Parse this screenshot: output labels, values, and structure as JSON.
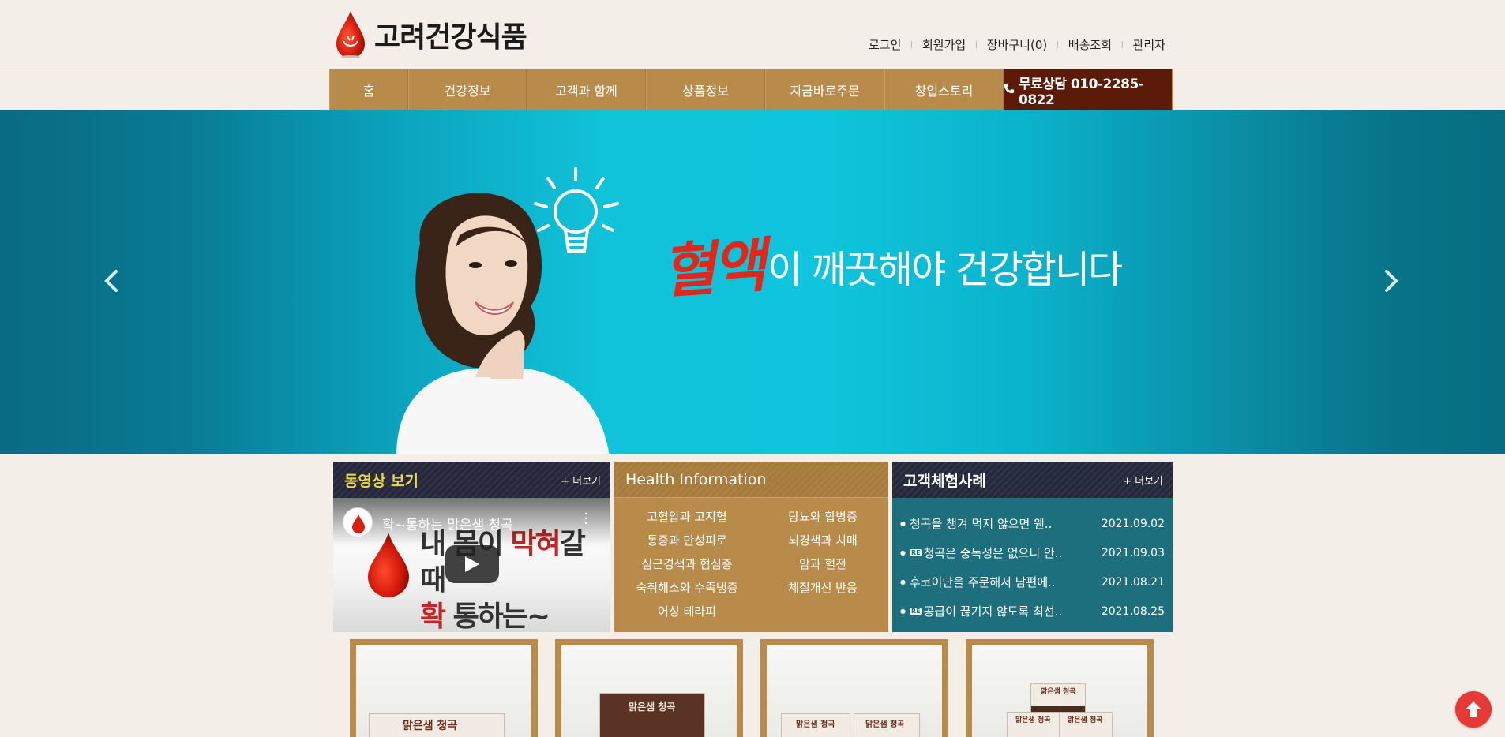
{
  "site": {
    "title": "고려건강식품"
  },
  "util_links": [
    "로그인",
    "회원가입",
    "장바구니(0)",
    "배송조회",
    "관리자"
  ],
  "nav": {
    "items": [
      "홈",
      "건강정보",
      "고객과 함께",
      "상품정보",
      "지금바로주문",
      "창업스토리"
    ],
    "consult": "무료상담 010-2285-0822"
  },
  "hero": {
    "highlight": "혈액",
    "text": "이 깨끗해야 건강합니다"
  },
  "video_panel": {
    "title": "동영상 보기",
    "more": "+ 더보기",
    "video_title": "확~통하는 맑은샘 청곡",
    "caption_line1_a": "내 몸이 ",
    "caption_line1_b": "막혀",
    "caption_line1_c": "갈 때",
    "caption_line2_a": "확",
    "caption_line2_b": " 통하는~"
  },
  "health_panel": {
    "title": "Health Information",
    "items": [
      "고혈압과 고지혈",
      "당뇨와 합병증",
      "통증과 만성피로",
      "뇌경색과 치매",
      "심근경색과 협심증",
      "암과 혈전",
      "숙취해소와 수족냉증",
      "체질개선 반응",
      "어싱 테라피"
    ]
  },
  "review_panel": {
    "title": "고객체험사례",
    "more": "+ 더보기",
    "rows": [
      {
        "title": "청곡을 챙겨 먹지 않으면 웬..",
        "date": "2021.09.02",
        "reply": false
      },
      {
        "title": "청곡은 중독성은 없으니 안..",
        "date": "2021.09.03",
        "reply": true
      },
      {
        "title": "후코이단을 주문해서 남편에..",
        "date": "2021.08.21",
        "reply": false
      },
      {
        "title": "공급이 끊기지 않도록 최선..",
        "date": "2021.08.25",
        "reply": true
      }
    ],
    "reply_badge": "RE"
  },
  "products": {
    "label": "맑은샘 청곡"
  },
  "colors": {
    "gold": "#b98b4a",
    "dark_brown": "#5b1b08",
    "teal": "#1d6f7e",
    "hero": "#10c2da"
  }
}
